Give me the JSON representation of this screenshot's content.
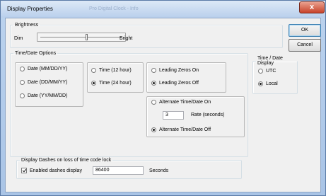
{
  "window": {
    "title": "Display Properties",
    "blurred_title": "Pro Digital Clock - Info",
    "close_label": "x"
  },
  "brightness": {
    "legend": "Brightness",
    "min_label": "Dim",
    "max_label": "Bright",
    "level": 0.57
  },
  "buttons": {
    "ok": "OK",
    "cancel": "Cancel"
  },
  "time_date_options": {
    "legend": "Time/Date Options",
    "date_formats": [
      {
        "label": "Date (MM/DD/YY)",
        "checked": false
      },
      {
        "label": "Date (DD/MM/YY)",
        "checked": false
      },
      {
        "label": "Date (YY/MM/DD)",
        "checked": false
      }
    ],
    "time_formats": [
      {
        "label": "Time (12 hour)",
        "checked": false
      },
      {
        "label": "Time (24 hour)",
        "checked": true
      }
    ],
    "leading_zeros": [
      {
        "label": "Leading Zeros On",
        "checked": false
      },
      {
        "label": "Leading Zeros Off",
        "checked": true
      }
    ],
    "alternate": {
      "on_label": "Alternate Time/Date On",
      "on_checked": false,
      "rate_value": "3",
      "rate_label": "Rate (seconds)",
      "off_label": "Alternate Time/Date Off",
      "off_checked": true
    }
  },
  "time_date_display": {
    "legend": "Time / Date Display",
    "options": [
      {
        "label": "UTC",
        "checked": false
      },
      {
        "label": "Local",
        "checked": true
      }
    ]
  },
  "dashes": {
    "legend": "Display Dashes on loss of time code lock",
    "checkbox_label": "Enabled dashes display",
    "checked": true,
    "value": "86400",
    "unit": "Seconds"
  }
}
